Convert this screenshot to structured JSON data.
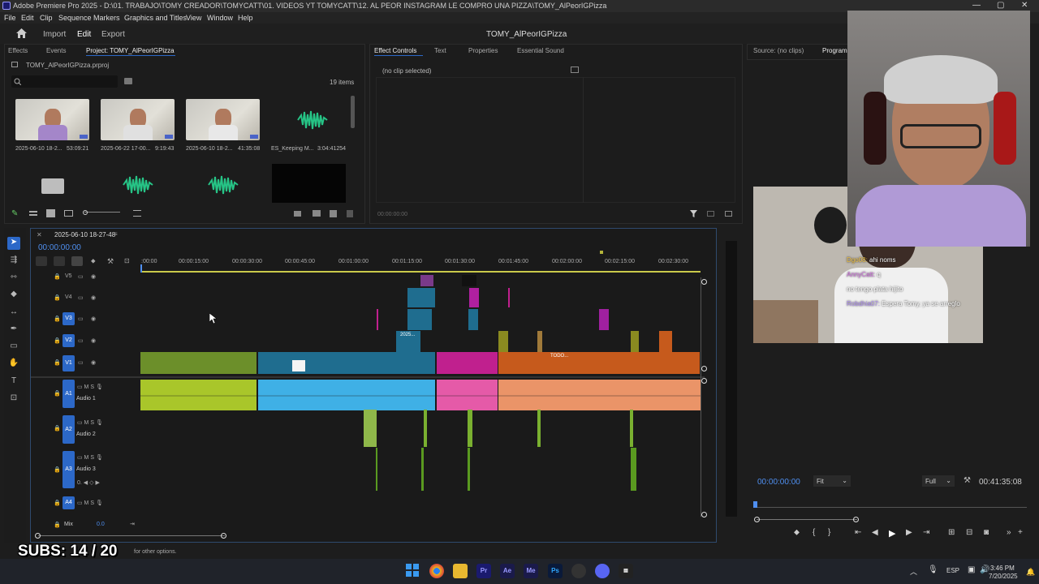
{
  "window": {
    "title": "Adobe Premiere Pro 2025 - D:\\01. TRABAJO\\TOMY CREADOR\\TOMYCATT\\01. VIDEOS YT  TOMYCATT\\12. AL PEOR INSTAGRAM LE COMPRO UNA PIZZA\\TOMY_AlPeorIGPizza",
    "minimize": "—",
    "maximize": "▢",
    "close": "✕"
  },
  "menu": [
    "File",
    "Edit",
    "Clip",
    "Sequence",
    "Markers",
    "Graphics and Titles",
    "View",
    "Window",
    "Help"
  ],
  "header": {
    "import": "Import",
    "edit": "Edit",
    "export": "Export",
    "project_title": "TOMY_AlPeorIGPizza"
  },
  "project_panel": {
    "tabs": [
      "Effects",
      "Events",
      "Project: TOMY_AlPeorIGPizza"
    ],
    "file": "TOMY_AlPeorIGPizza.prproj",
    "items_count": "19 items",
    "search_placeholder": "",
    "items": [
      {
        "name": "2025-06-10 18-2...",
        "duration": "53:09:21"
      },
      {
        "name": "2025-06-22 17-00...",
        "duration": "9:19:43"
      },
      {
        "name": "2025-06-10 18-2...",
        "duration": "41:35:08"
      },
      {
        "name": "ES_Keeping M...",
        "duration": "3:04:41254"
      }
    ]
  },
  "effect_controls": {
    "tabs": [
      "Effect Controls",
      "Text",
      "Properties",
      "Essential Sound"
    ],
    "empty": "(no clip selected)",
    "timecode": "00:00:00:00"
  },
  "source_tabs": [
    "Source: (no clips)",
    "Program:"
  ],
  "timeline": {
    "sequence": "2025-06-10 18-27-48",
    "timecode": "00:00:00:00",
    "ruler": [
      ":00:00",
      "00:00:15:00",
      "00:00:30:00",
      "00:00:45:00",
      "00:01:00:00",
      "00:01:15:00",
      "00:01:30:00",
      "00:01:45:00",
      "00:02:00:00",
      "00:02:15:00",
      "00:02:30:00"
    ],
    "video_tracks": [
      "V5",
      "V4",
      "V3",
      "V2",
      "V1"
    ],
    "audio_tracks": [
      {
        "id": "A1",
        "name": "Audio 1"
      },
      {
        "id": "A2",
        "name": "Audio 2"
      },
      {
        "id": "A3",
        "name": "Audio 3"
      },
      {
        "id": "A4",
        "name": ""
      }
    ],
    "mix_label": "Mix",
    "mix_value": "0.0",
    "clip_labels": [
      "2025...",
      "TODO..."
    ]
  },
  "program": {
    "timecode": "00:00:00:00",
    "fit": "Fit",
    "quality": "Full",
    "duration": "00:41:35:08"
  },
  "chat": [
    {
      "user": "Dgo08:",
      "text": "ahi noms",
      "color": "#f0c040"
    },
    {
      "user": "AnnyCatt:",
      "text": "q",
      "color": "#d070e0"
    },
    {
      "user": "",
      "text": "no tengo plata hijito",
      "color": "#e05060"
    },
    {
      "user": "Robdhia07:",
      "text": "Espera Tomy, ya se arreglo",
      "color": "#b090f0"
    }
  ],
  "status": {
    "hint": "for other options.",
    "subs": "SUBS: 14 / 20"
  },
  "taskbar": {
    "lang": "ESP",
    "time": "3:46 PM",
    "date": "7/20/2025"
  },
  "colors": {
    "accent": "#2c68c8",
    "green_clip": "#6c8f2a",
    "teal_clip": "#1f6d8f",
    "pink_clip": "#c0208e",
    "orange_clip": "#c65a1c"
  }
}
